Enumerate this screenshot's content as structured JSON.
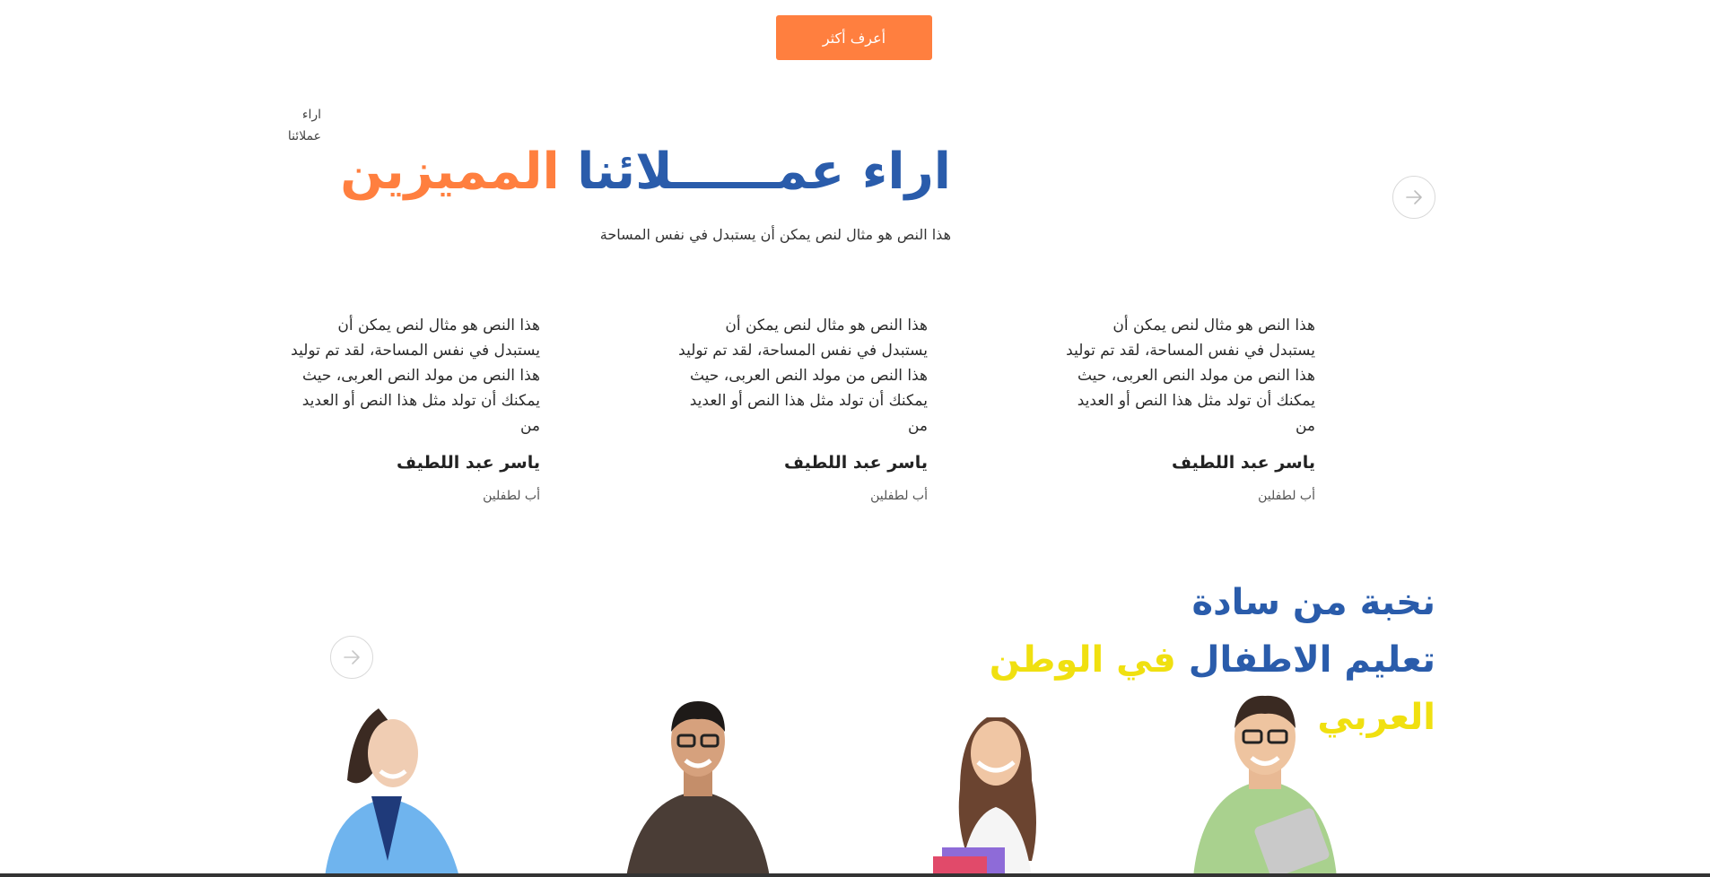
{
  "cta": {
    "label": "أعرف أكثر"
  },
  "side_label": {
    "line1": "اراء",
    "line2": "عملائنا"
  },
  "testimonials": {
    "title_part1": "اراء عمــــــلائنا",
    "title_part2": "المميزين",
    "subtitle": "هذا النص هو مثال لنص يمكن أن يستبدل في نفس المساحة",
    "items": [
      {
        "quote": "هذا النص هو مثال لنص يمكن أن يستبدل في نفس المساحة، لقد تم توليد هذا النص من مولد النص العربى، حيث يمكنك أن تولد مثل هذا النص أو العديد من",
        "name": "ياسر عبد اللطيف",
        "role": "أب لطفلين"
      },
      {
        "quote": "هذا النص هو مثال لنص يمكن أن يستبدل في نفس المساحة، لقد تم توليد هذا النص من مولد النص العربى، حيث يمكنك أن تولد مثل هذا النص أو العديد من",
        "name": "ياسر عبد اللطيف",
        "role": "أب لطفلين"
      },
      {
        "quote": "هذا النص هو مثال لنص يمكن أن يستبدل في نفس المساحة، لقد تم توليد هذا النص من مولد النص العربى، حيث يمكنك أن تولد مثل هذا النص أو العديد من",
        "name": "ياسر عبد اللطيف",
        "role": "أب لطفلين"
      }
    ]
  },
  "elite": {
    "line1": "نخبة من سادة",
    "line2_part1": "تعليم الاطفال",
    "line2_part2": "في الوطن العربي"
  },
  "icons": {
    "arrow_right": "arrow-right-icon"
  },
  "colors": {
    "brand_blue": "#2a5cab",
    "accent_orange": "#ff7f3f",
    "accent_yellow": "#f0e010"
  }
}
